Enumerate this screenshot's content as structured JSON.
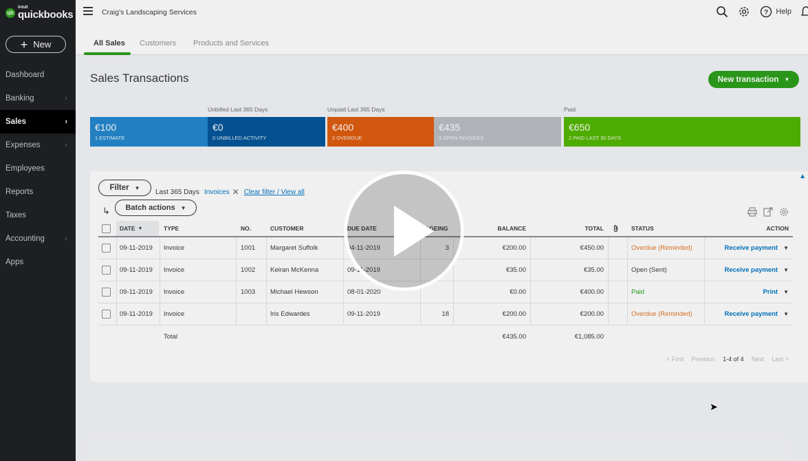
{
  "brand": {
    "intuit": "intuit",
    "name": "quickbooks",
    "mark": "qb"
  },
  "sidebar": {
    "new_label": "New",
    "items": [
      {
        "label": "Dashboard",
        "chevron": ""
      },
      {
        "label": "Banking",
        "chevron": "›"
      },
      {
        "label": "Sales",
        "chevron": "›"
      },
      {
        "label": "Expenses",
        "chevron": "›"
      },
      {
        "label": "Employees",
        "chevron": ""
      },
      {
        "label": "Reports",
        "chevron": ""
      },
      {
        "label": "Taxes",
        "chevron": ""
      },
      {
        "label": "Accounting",
        "chevron": "›"
      },
      {
        "label": "Apps",
        "chevron": ""
      }
    ],
    "active_index": 2
  },
  "topbar": {
    "company": "Craig's Landscaping Services",
    "help_label": "Help"
  },
  "tabs": [
    {
      "label": "All Sales"
    },
    {
      "label": "Customers"
    },
    {
      "label": "Products and Services"
    }
  ],
  "page": {
    "title": "Sales Transactions",
    "new_transaction_label": "New transaction"
  },
  "money_bar": {
    "labels": {
      "unbilled": "Unbilled Last 365 Days",
      "unpaid": "Unpaid Last 365 Days",
      "paid": "Paid"
    },
    "segments": [
      {
        "amount": "€100",
        "sub": "1 Estimate",
        "color": "#2589cf"
      },
      {
        "amount": "€0",
        "sub": "0 Unbilled Activity",
        "color": "#05579b"
      },
      {
        "amount": "€400",
        "sub": "2 Overdue",
        "color": "#e05d0f"
      },
      {
        "amount": "€435",
        "sub": "3 Open Invoices",
        "color": "#babec5"
      },
      {
        "amount": "€650",
        "sub": "2 Paid Last 30 Days",
        "color": "#53b700"
      }
    ]
  },
  "filters": {
    "filter_label": "Filter",
    "range": "Last 365 Days",
    "tag": "Invoices",
    "clear": "Clear filter / View all",
    "batch_label": "Batch actions"
  },
  "table": {
    "headers": {
      "date": "DATE",
      "type": "TYPE",
      "no": "NO.",
      "customer": "CUSTOMER",
      "due": "DUE DATE",
      "aging": "AGEING",
      "balance": "BALANCE",
      "total": "TOTAL",
      "status": "STATUS",
      "action": "ACTION"
    },
    "rows": [
      {
        "date": "09-11-2019",
        "type": "Invoice",
        "no": "1001",
        "customer": "Margaret Suffolk",
        "due": "04-11-2019",
        "aging": "3",
        "balance": "€200.00",
        "total": "€450.00",
        "status": "Overdue (Reminded)",
        "status_kind": "overdue",
        "action": "Receive payment"
      },
      {
        "date": "09-11-2019",
        "type": "Invoice",
        "no": "1002",
        "customer": "Keiran McKenna",
        "due": "09-11-2019",
        "aging": "",
        "balance": "€35.00",
        "total": "€35.00",
        "status": "Open (Sent)",
        "status_kind": "open",
        "action": "Receive payment"
      },
      {
        "date": "09-11-2019",
        "type": "Invoice",
        "no": "1003",
        "customer": "Michael Hewson",
        "due": "08-01-2020",
        "aging": "",
        "balance": "€0.00",
        "total": "€400.00",
        "status": "Paid",
        "status_kind": "paid",
        "action": "Print"
      },
      {
        "date": "09-11-2019",
        "type": "Invoice",
        "no": "",
        "customer": "Iris Edwardes",
        "due": "09-11-2019",
        "aging": "18",
        "balance": "€200.00",
        "total": "€200.00",
        "status": "Overdue (Reminded)",
        "status_kind": "overdue",
        "action": "Receive payment"
      }
    ],
    "total_row": {
      "label": "Total",
      "balance": "€435.00",
      "total": "€1,085.00"
    }
  },
  "pagination": {
    "first": "< First",
    "previous": "Previous",
    "current": "1-4 of 4",
    "next": "Next",
    "last": "Last >"
  }
}
